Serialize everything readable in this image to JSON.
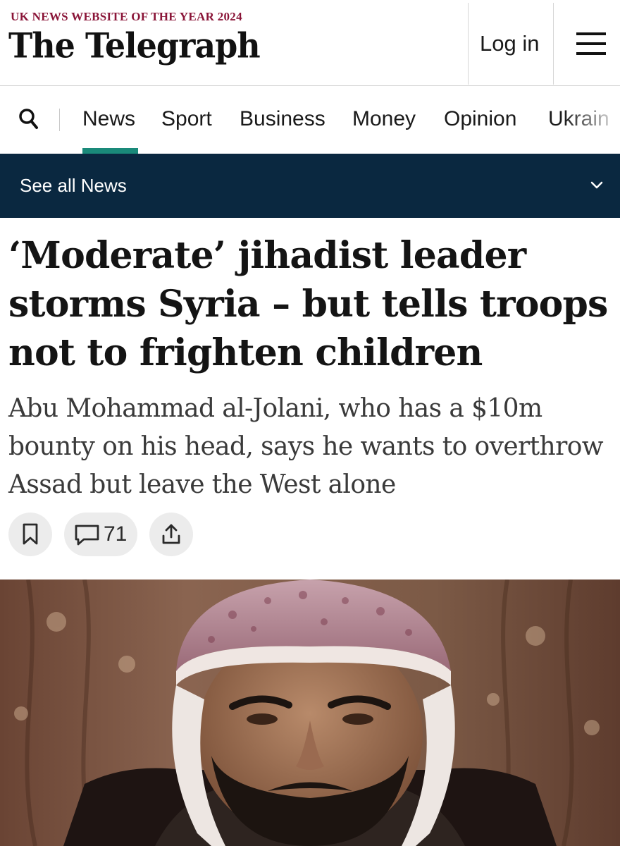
{
  "header": {
    "award": "UK NEWS WEBSITE OF THE YEAR 2024",
    "masthead": "The Telegraph",
    "login_label": "Log in",
    "menu_icon": "hamburger-menu-icon"
  },
  "nav": {
    "search_icon": "search-icon",
    "items": [
      {
        "label": "News",
        "active": true
      },
      {
        "label": "Sport",
        "active": false
      },
      {
        "label": "Business",
        "active": false
      },
      {
        "label": "Money",
        "active": false
      },
      {
        "label": "Opinion",
        "active": false
      },
      {
        "label": "Ukrain",
        "active": false
      }
    ],
    "active_color": "#1a8a7a"
  },
  "section_bar": {
    "label": "See all News",
    "chevron_icon": "chevron-down-icon",
    "background": "#0a2840"
  },
  "article": {
    "headline": "‘Moderate’ jihadist leader storms Syria – but tells troops not to frighten children",
    "standfirst": "Abu Mohammad al-Jolani, who has a $10m bounty on his head, says he wants to overthrow Assad but leave the West alone",
    "actions": {
      "save_icon": "bookmark-icon",
      "comment_icon": "comment-icon",
      "comment_count": "71",
      "share_icon": "share-icon"
    }
  },
  "colors": {
    "award_text": "#8a1538",
    "accent": "#1a8a7a",
    "section_bar": "#0a2840"
  }
}
